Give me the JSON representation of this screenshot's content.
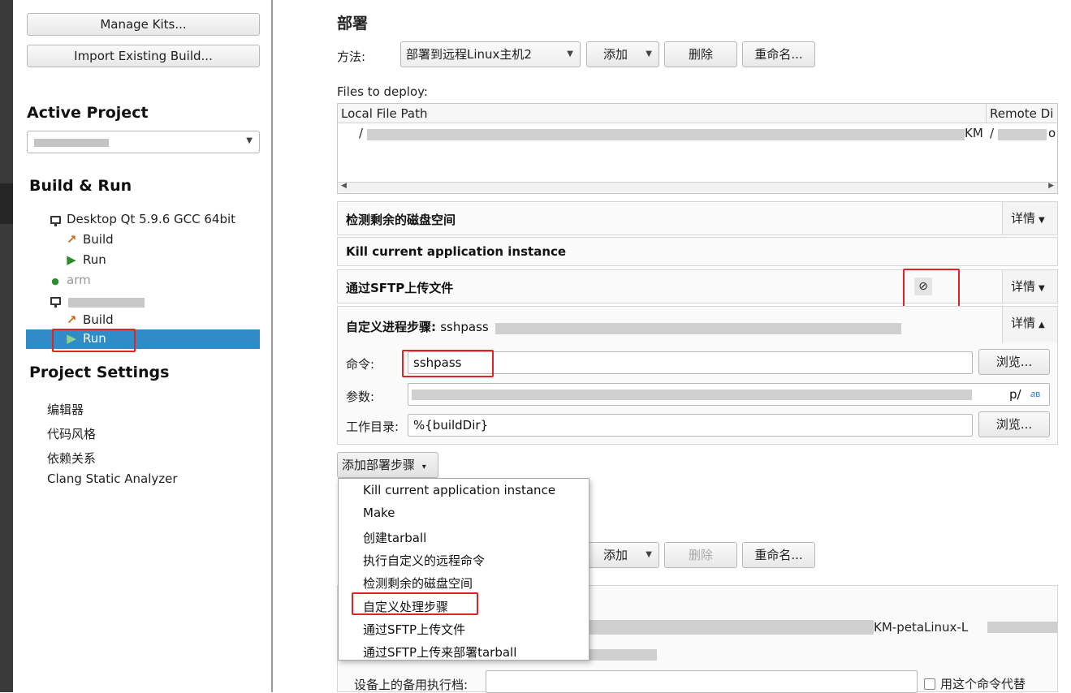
{
  "sidebar": {
    "manage_kits_label": "Manage Kits...",
    "import_build_label": "Import Existing Build...",
    "active_project_heading": "Active Project",
    "build_run_heading": "Build & Run",
    "kits": [
      {
        "name": "Desktop Qt 5.9.6 GCC 64bit",
        "build_label": "Build",
        "run_label": "Run"
      },
      {
        "name": "arm"
      }
    ],
    "second_kit": {
      "build_label": "Build",
      "run_label": "Run"
    },
    "project_settings_heading": "Project Settings",
    "settings_items": [
      "编辑器",
      "代码风格",
      "依赖关系",
      "Clang Static Analyzer"
    ]
  },
  "deploy": {
    "heading": "部署",
    "method_label": "方法:",
    "method_value": "部署到远程Linux主机2",
    "add_label": "添加",
    "delete_label": "删除",
    "rename_label": "重命名...",
    "files_label": "Files to deploy:",
    "table": {
      "col_local": "Local File Path",
      "col_remote": "Remote Di",
      "row_local_start": "/",
      "row_local_end": "KM",
      "row_remote_start": "/",
      "row_remote_end": "o"
    },
    "steps": {
      "disk_space": "检测剩余的磁盘空间",
      "kill_app": "Kill current application instance",
      "sftp_upload": "通过SFTP上传文件",
      "custom_step_title": "自定义进程步骤:",
      "custom_step_value": "sshpass",
      "details_label": "详情"
    },
    "custom_form": {
      "command_label": "命令:",
      "command_value": "sshpass",
      "browse_label": "浏览...",
      "args_label": "参数:",
      "args_tail": "p/",
      "workdir_label": "工作目录:",
      "workdir_value": "%{buildDir}"
    },
    "add_step_label": "添加部署步骤"
  },
  "dropdown_menu": {
    "items": [
      "Kill current application instance",
      "Make",
      "创建tarball",
      "执行自定义的远程命令",
      "检测剩余的磁盘空间",
      "自定义处理步骤",
      "通过SFTP上传文件",
      "通过SFTP上传来部署tarball"
    ]
  },
  "run_section": {
    "add_label": "添加",
    "delete_label": "删除",
    "rename_label": "重命名...",
    "path_tail": "KM-petaLinux-L",
    "alt_exec_label": "设备上的备用执行档:",
    "use_cmd_label": "用这个命令代替"
  },
  "colors": {
    "selection": "#308cc6",
    "highlight_box": "#e02424"
  }
}
